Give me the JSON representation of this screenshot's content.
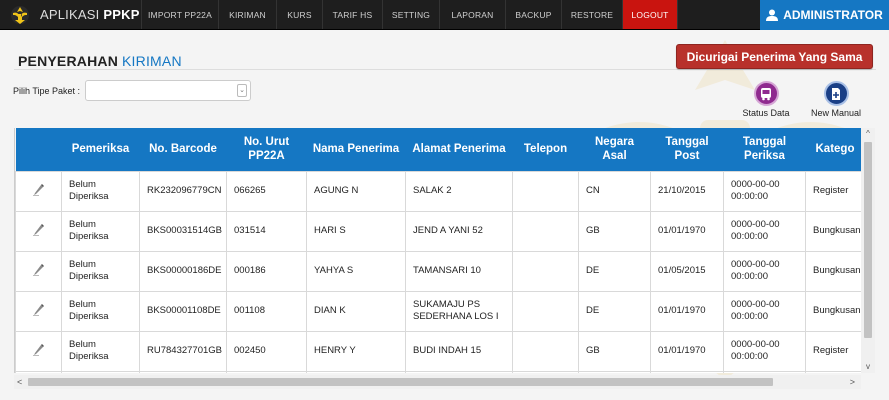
{
  "app": {
    "name_light": "APLIKASI",
    "name_bold": "PPKP"
  },
  "nav": [
    {
      "label": "IMPORT PP22A",
      "name": "nav-import-pp22a"
    },
    {
      "label": "KIRIMAN",
      "name": "nav-kiriman"
    },
    {
      "label": "KURS",
      "name": "nav-kurs"
    },
    {
      "label": "TARIF HS",
      "name": "nav-tarif-hs"
    },
    {
      "label": "SETTING",
      "name": "nav-setting"
    },
    {
      "label": "LAPORAN",
      "name": "nav-laporan"
    },
    {
      "label": "BACKUP",
      "name": "nav-backup"
    },
    {
      "label": "RESTORE",
      "name": "nav-restore"
    },
    {
      "label": "LOGOUT",
      "name": "nav-logout"
    }
  ],
  "user": {
    "label": "ADMINISTRATOR"
  },
  "page": {
    "title": "PENYERAHAN",
    "subtitle": "KIRIMAN"
  },
  "actions": {
    "suspect_label": "Dicurigai Penerima Yang Sama",
    "status_data": "Status Data",
    "new_manual": "New Manual"
  },
  "filter": {
    "label": "Pilih Tipe Paket :",
    "value": ""
  },
  "table": {
    "headers": [
      "",
      "Pemeriksa",
      "No. Barcode",
      "No. Urut PP22A",
      "Nama Penerima",
      "Alamat Penerima",
      "Telepon",
      "Negara Asal",
      "Tanggal Post",
      "Tanggal Periksa",
      "Katego"
    ],
    "rows": [
      [
        "",
        "Belum Diperiksa",
        "RK232096779CN",
        "066265",
        "AGUNG N",
        "SALAK 2",
        "",
        "CN",
        "21/10/2015",
        "0000-00-00 00:00:00",
        "Register"
      ],
      [
        "",
        "Belum Diperiksa",
        "BKS00031514GB",
        "031514",
        "HARI S",
        "JEND A YANI 52",
        "",
        "GB",
        "01/01/1970",
        "0000-00-00 00:00:00",
        "Bungkusan"
      ],
      [
        "",
        "Belum Diperiksa",
        "BKS00000186DE",
        "000186",
        "YAHYA S",
        "TAMANSARI 10",
        "",
        "DE",
        "01/05/2015",
        "0000-00-00 00:00:00",
        "Bungkusan"
      ],
      [
        "",
        "Belum Diperiksa",
        "BKS00001108DE",
        "001108",
        "DIAN K",
        "SUKAMAJU PS SEDERHANA LOS I",
        "",
        "DE",
        "01/01/1970",
        "0000-00-00 00:00:00",
        "Bungkusan"
      ],
      [
        "",
        "Belum Diperiksa",
        "RU784327701GB",
        "002450",
        "HENRY Y",
        "BUDI INDAH 15",
        "",
        "GB",
        "01/01/1970",
        "0000-00-00 00:00:00",
        "Register"
      ],
      [
        "",
        "",
        "",
        "",
        "",
        "",
        "",
        "",
        "",
        "",
        ""
      ]
    ]
  },
  "scroll": {
    "up": "^",
    "down": "v",
    "left": "<",
    "right": ">"
  },
  "colors": {
    "nav_bg": "#1e1e1e",
    "accent": "#1577c3",
    "logout": "#c9140f",
    "suspect_button": "#b8312b"
  }
}
